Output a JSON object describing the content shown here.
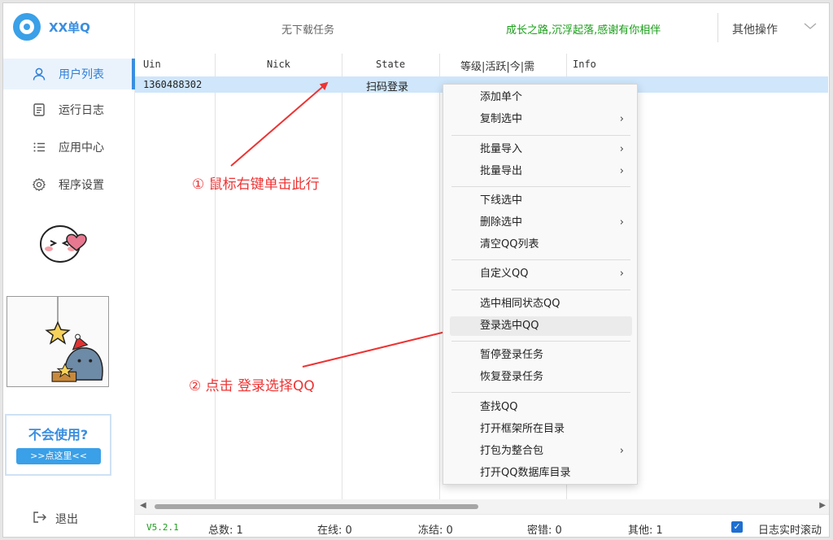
{
  "app": {
    "title": "XX单Q"
  },
  "sidebar": {
    "items": [
      {
        "label": "用户列表",
        "icon": "user-icon",
        "active": true
      },
      {
        "label": "运行日志",
        "icon": "document-icon",
        "active": false
      },
      {
        "label": "应用中心",
        "icon": "list-icon",
        "active": false
      },
      {
        "label": "程序设置",
        "icon": "gear-icon",
        "active": false
      }
    ],
    "help": {
      "title": "不会使用?",
      "button": ">>点这里<<"
    },
    "exit_label": "退出"
  },
  "header": {
    "status": "无下载任务",
    "slogan": "成长之路,沉浮起落,感谢有你相伴",
    "other_ops": "其他操作"
  },
  "grid": {
    "columns": [
      "Uin",
      "Nick",
      "State",
      "等级|活跃|今|需",
      "Info"
    ],
    "rows": [
      {
        "uin": "1360488302",
        "nick": "",
        "state": "扫码登录",
        "level": "",
        "info": ""
      }
    ]
  },
  "context_menu": {
    "items": [
      {
        "label": "添加单个",
        "submenu": false
      },
      {
        "label": "复制选中",
        "submenu": true
      },
      {
        "label": "批量导入",
        "submenu": true
      },
      {
        "label": "批量导出",
        "submenu": true
      },
      {
        "label": "下线选中",
        "submenu": false
      },
      {
        "label": "删除选中",
        "submenu": true
      },
      {
        "label": "清空QQ列表",
        "submenu": false
      },
      {
        "label": "自定义QQ",
        "submenu": true
      },
      {
        "label": "选中相同状态QQ",
        "submenu": false
      },
      {
        "label": "登录选中QQ",
        "submenu": false,
        "highlighted": true
      },
      {
        "label": "暂停登录任务",
        "submenu": false
      },
      {
        "label": "恢复登录任务",
        "submenu": false
      },
      {
        "label": "查找QQ",
        "submenu": false
      },
      {
        "label": "打开框架所在目录",
        "submenu": false
      },
      {
        "label": "打包为整合包",
        "submenu": true
      },
      {
        "label": "打开QQ数据库目录",
        "submenu": false
      }
    ],
    "submenu_glyph": "›"
  },
  "annotations": {
    "step1": "① 鼠标右键单击此行",
    "step2": "② 点击 登录选择QQ"
  },
  "statusbar": {
    "version": "V5.2.1",
    "total": "总数: 1",
    "online": "在线: 0",
    "frozen": "冻结: 0",
    "pwd_error": "密错: 0",
    "other": "其他: 1",
    "log_scroll_label": "日志实时滚动",
    "log_scroll_checked": true
  },
  "colors": {
    "accent": "#3a8ee0",
    "selection": "#cfe6fb",
    "slogan": "#1a9e1a",
    "annotation": "#e33333"
  }
}
